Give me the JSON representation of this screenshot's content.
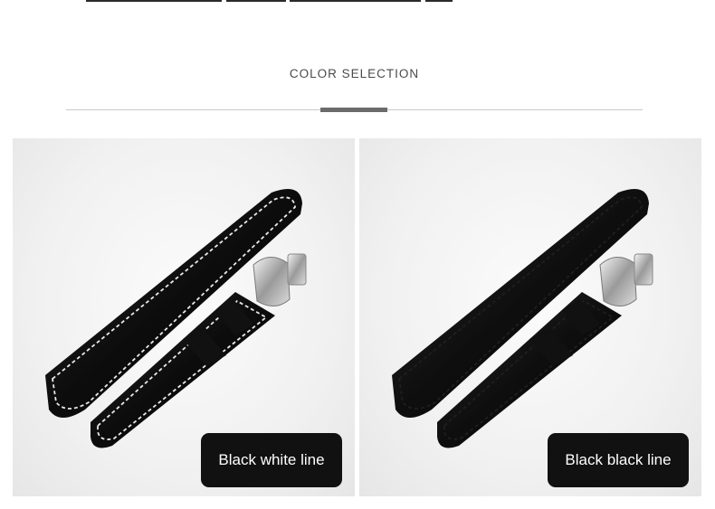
{
  "header": {
    "title": "COLOR SELECTION"
  },
  "options": [
    {
      "label": "Black white line",
      "strap_color": "#0c0c0c",
      "stitch_color": "#e8e8e8"
    },
    {
      "label": "Black black line",
      "strap_color": "#0c0c0c",
      "stitch_color": "#1a1a1a"
    }
  ],
  "colors": {
    "text": "#4a4a4a",
    "divider": "#c8c8c8",
    "accent": "#6b6b6b",
    "chip": "#111111"
  }
}
